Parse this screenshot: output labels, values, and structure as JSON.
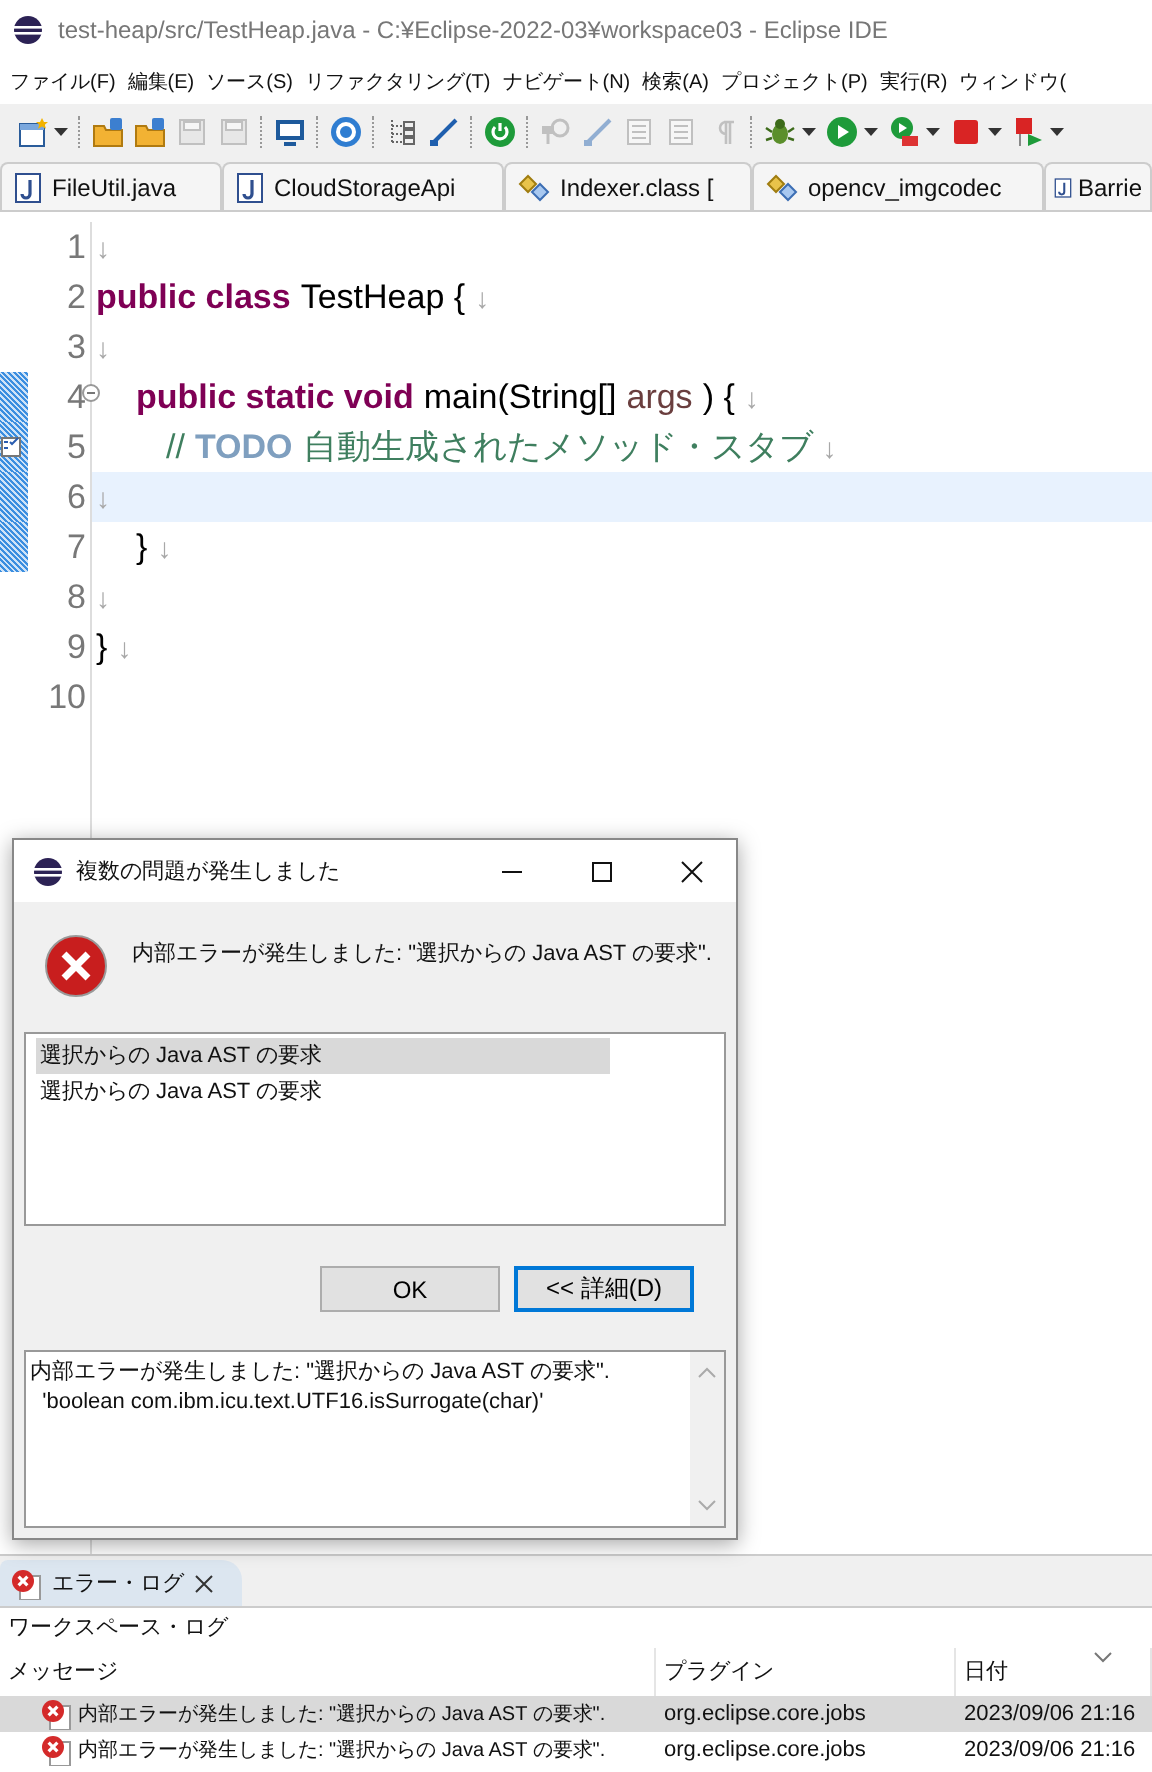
{
  "window": {
    "title": "test-heap/src/TestHeap.java - C:¥Eclipse-2022-03¥workspace03 - Eclipse IDE"
  },
  "menu": [
    "ファイル(F)",
    "編集(E)",
    "ソース(S)",
    "リファクタリング(T)",
    "ナビゲート(N)",
    "検索(A)",
    "プロジェクト(P)",
    "実行(R)",
    "ウィンドウ("
  ],
  "toolbar": [
    {
      "kind": "new",
      "disabled": false,
      "dropdown": true
    },
    {
      "kind": "sep"
    },
    {
      "kind": "folder",
      "disabled": false,
      "dropdown": false
    },
    {
      "kind": "folder",
      "disabled": false,
      "dropdown": false
    },
    {
      "kind": "save",
      "disabled": true,
      "dropdown": false
    },
    {
      "kind": "save",
      "disabled": true,
      "dropdown": false
    },
    {
      "kind": "sep"
    },
    {
      "kind": "monitor",
      "disabled": false,
      "dropdown": false
    },
    {
      "kind": "sep"
    },
    {
      "kind": "gear",
      "disabled": false,
      "dropdown": false
    },
    {
      "kind": "sep"
    },
    {
      "kind": "tree",
      "disabled": false,
      "dropdown": false
    },
    {
      "kind": "pen",
      "disabled": false,
      "dropdown": false
    },
    {
      "kind": "sep"
    },
    {
      "kind": "power",
      "disabled": false,
      "dropdown": false
    },
    {
      "kind": "sep"
    },
    {
      "kind": "pin",
      "disabled": true,
      "dropdown": false
    },
    {
      "kind": "pen",
      "disabled": true,
      "dropdown": false
    },
    {
      "kind": "doc",
      "disabled": true,
      "dropdown": false
    },
    {
      "kind": "doc",
      "disabled": true,
      "dropdown": false
    },
    {
      "kind": "pilcrow",
      "disabled": true,
      "dropdown": false
    },
    {
      "kind": "sep"
    },
    {
      "kind": "bug",
      "disabled": false,
      "dropdown": true
    },
    {
      "kind": "run",
      "disabled": false,
      "dropdown": true
    },
    {
      "kind": "runext",
      "disabled": false,
      "dropdown": true
    },
    {
      "kind": "stop",
      "disabled": false,
      "dropdown": true
    },
    {
      "kind": "flag",
      "disabled": false,
      "dropdown": true
    }
  ],
  "editor_tabs": [
    {
      "label": "FileUtil.java",
      "kind": "java"
    },
    {
      "label": "CloudStorageApi",
      "kind": "java"
    },
    {
      "label": "Indexer.class [",
      "kind": "class"
    },
    {
      "label": "opencv_imgcodec",
      "kind": "class"
    },
    {
      "label": "Barrie",
      "kind": "java"
    }
  ],
  "editor": {
    "lines": [
      {
        "number": "1",
        "tokens": [
          {
            "kind": "eol",
            "text": "↓"
          }
        ],
        "changed": false,
        "current": false,
        "foldable": false,
        "task": false
      },
      {
        "number": "2",
        "tokens": [
          {
            "kind": "keyword",
            "text": "public class"
          },
          {
            "kind": "plain",
            "text": "TestHeap {"
          },
          {
            "kind": "eol",
            "text": "↓"
          }
        ],
        "changed": false,
        "current": false,
        "foldable": false,
        "task": false
      },
      {
        "number": "3",
        "tokens": [
          {
            "kind": "eol",
            "text": "↓"
          }
        ],
        "changed": false,
        "current": false,
        "foldable": false,
        "task": false
      },
      {
        "number": "4",
        "tokens": [
          {
            "kind": "indent"
          },
          {
            "kind": "keyword",
            "text": "public static void"
          },
          {
            "kind": "plain",
            "text": "main(String[]"
          },
          {
            "kind": "variable",
            "text": "args"
          },
          {
            "kind": "plain",
            "text": ") {"
          },
          {
            "kind": "eol",
            "text": "↓"
          }
        ],
        "changed": true,
        "current": false,
        "foldable": true,
        "task": false
      },
      {
        "number": "5",
        "tokens": [
          {
            "kind": "indent2"
          },
          {
            "kind": "comment",
            "text": "//"
          },
          {
            "kind": "task_tag",
            "text": "TODO"
          },
          {
            "kind": "comment",
            "text": "自動生成されたメソッド・スタブ"
          },
          {
            "kind": "eol",
            "text": "↓"
          }
        ],
        "changed": true,
        "current": false,
        "foldable": false,
        "task": true
      },
      {
        "number": "6",
        "tokens": [
          {
            "kind": "eol",
            "text": "↓"
          }
        ],
        "changed": true,
        "current": true,
        "foldable": false,
        "task": false
      },
      {
        "number": "7",
        "tokens": [
          {
            "kind": "indent"
          },
          {
            "kind": "plain",
            "text": "}"
          },
          {
            "kind": "eol",
            "text": "↓"
          }
        ],
        "changed": true,
        "current": false,
        "foldable": false,
        "task": false
      },
      {
        "number": "8",
        "tokens": [
          {
            "kind": "eol",
            "text": "↓"
          }
        ],
        "changed": false,
        "current": false,
        "foldable": false,
        "task": false
      },
      {
        "number": "9",
        "tokens": [
          {
            "kind": "plain",
            "text": "}"
          },
          {
            "kind": "eol",
            "text": "↓"
          }
        ],
        "changed": false,
        "current": false,
        "foldable": false,
        "task": false
      },
      {
        "number": "10",
        "changed": false,
        "current": false,
        "foldable": false,
        "task": false
      }
    ]
  },
  "dialog": {
    "title": "複数の問題が発生しました",
    "message": "内部エラーが発生しました: \"選択からの Java AST の要求\".",
    "problems": [
      {
        "label": "選択からの Java AST の要求",
        "selected": true
      },
      {
        "label": "選択からの Java AST の要求",
        "selected": false
      }
    ],
    "buttons": [
      {
        "label": "OK",
        "focused": false
      },
      {
        "label": "<< 詳細(D)",
        "focused": true
      }
    ],
    "details": [
      "内部エラーが発生しました: \"選択からの Java AST の要求\".",
      "  'boolean com.ibm.icu.text.UTF16.isSurrogate(char)'"
    ]
  },
  "error_log": {
    "tab": "エラー・ログ",
    "scope": "ワークスペース・ログ",
    "columns": [
      "メッセージ",
      "プラグイン",
      "日付"
    ],
    "rows": [
      {
        "message": "内部エラーが発生しました: \"選択からの Java AST の要求\".",
        "plugin": "org.eclipse.core.jobs",
        "date": "2023/09/06 21:16",
        "selected": true
      },
      {
        "message": "内部エラーが発生しました: \"選択からの Java AST の要求\".",
        "plugin": "org.eclipse.core.jobs",
        "date": "2023/09/06 21:16",
        "selected": false
      }
    ]
  }
}
